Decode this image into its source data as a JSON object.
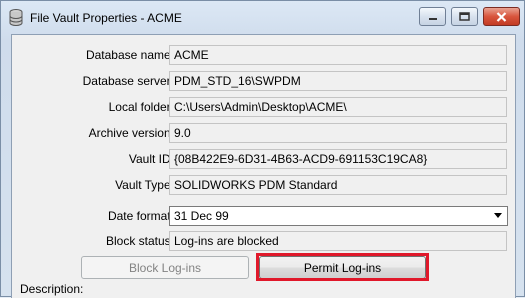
{
  "window": {
    "title": "File Vault Properties - ACME",
    "colors": {
      "highlight": "#e0182a",
      "close_button": "#c23b23"
    }
  },
  "fields": [
    {
      "label": "Database name:",
      "value": "ACME"
    },
    {
      "label": "Database server:",
      "value": "PDM_STD_16\\SWPDM"
    },
    {
      "label": "Local folder:",
      "value": "C:\\Users\\Admin\\Desktop\\ACME\\"
    },
    {
      "label": "Archive version:",
      "value": "9.0"
    },
    {
      "label": "Vault ID:",
      "value": "{08B422E9-6D31-4B63-ACD9-691153C19CA8}"
    },
    {
      "label": "Vault Type:",
      "value": "SOLIDWORKS PDM Standard"
    }
  ],
  "date_format": {
    "label": "Date format:",
    "value": "31 Dec 99"
  },
  "block_status": {
    "label": "Block status:",
    "value": "Log-ins are blocked"
  },
  "buttons": {
    "block": "Block Log-ins",
    "permit": "Permit Log-ins"
  },
  "description": {
    "label": "Description:"
  }
}
